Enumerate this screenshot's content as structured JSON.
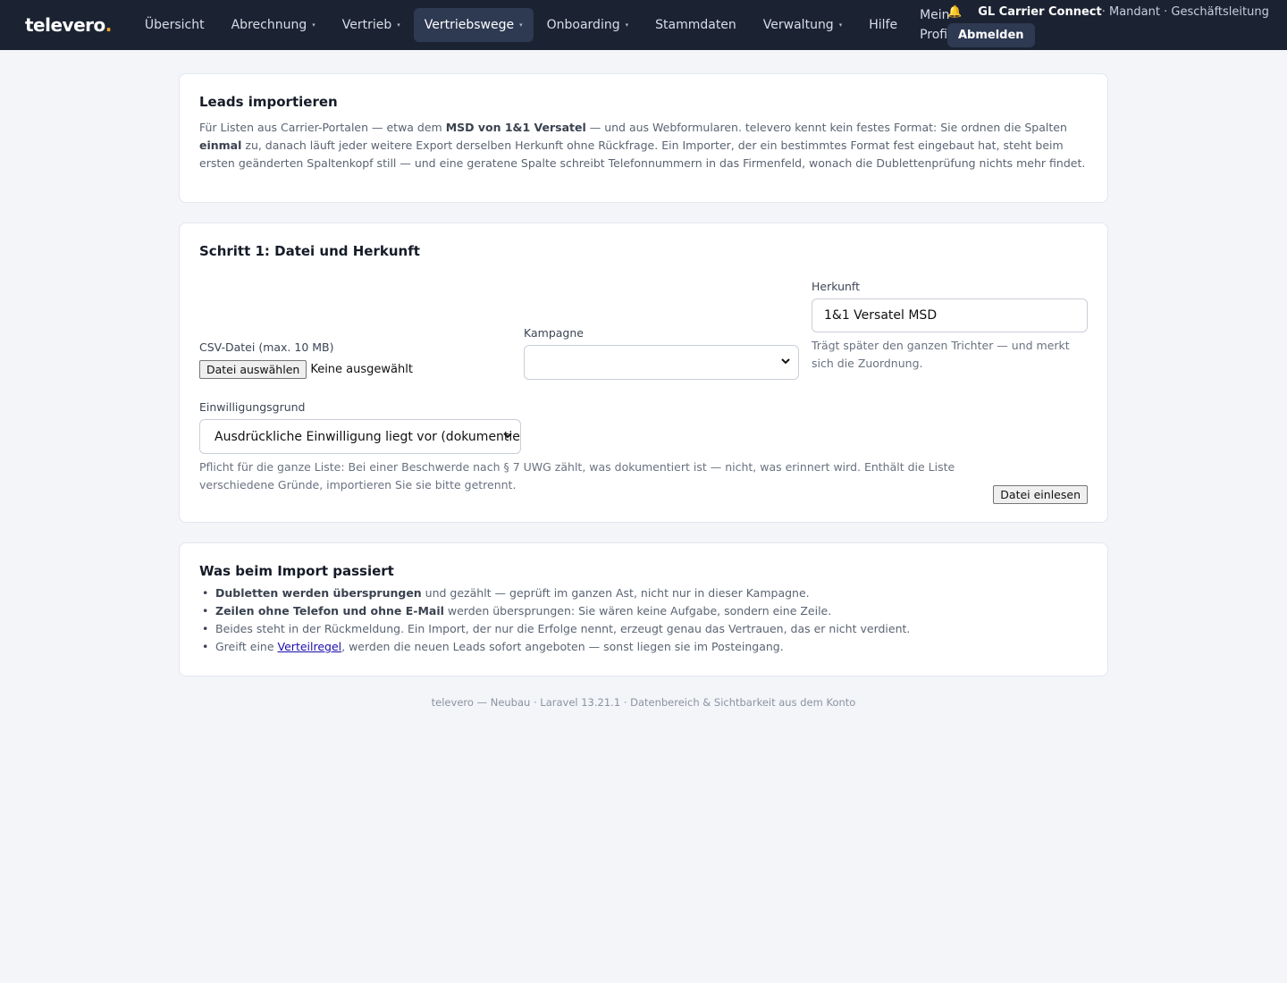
{
  "nav": {
    "logo": "televero",
    "logo_dot": ".",
    "items": [
      {
        "label": "Übersicht",
        "caret": false
      },
      {
        "label": "Abrechnung",
        "caret": true
      },
      {
        "label": "Vertrieb",
        "caret": true
      },
      {
        "label": "Vertriebswege",
        "caret": true,
        "active": true
      },
      {
        "label": "Onboarding",
        "caret": true
      },
      {
        "label": "Stammdaten",
        "caret": false
      },
      {
        "label": "Verwaltung",
        "caret": true
      },
      {
        "label": "Hilfe",
        "caret": false
      },
      {
        "label": "Mein Profil",
        "caret": false
      }
    ],
    "caret_glyph": "▾",
    "user": {
      "bell": "🔔",
      "tenant": "GL Carrier Connect",
      "role": " · Mandant · Geschäftsleitung",
      "logout": "Abmelden"
    }
  },
  "intro": {
    "title": "Leads importieren",
    "p1": "Für Listen aus Carrier-Portalen — etwa dem ",
    "b1": "MSD von 1&1 Versatel",
    "p2": " — und aus Webformularen. televero kennt kein festes Format: Sie ordnen die Spalten ",
    "b2": "einmal",
    "p3": " zu, danach läuft jeder weitere Export derselben Herkunft ohne Rückfrage. Ein Importer, der ein bestimmtes Format fest eingebaut hat, steht beim ersten geänderten Spaltenkopf still — und eine geratene Spalte schreibt Telefonnummern in das Firmenfeld, wonach die Dublettenprüfung nichts mehr findet."
  },
  "step1": {
    "title": "Schritt 1: Datei und Herkunft",
    "csv_label": "CSV-Datei (max. 10 MB)",
    "file_button": "Datei auswählen",
    "file_status": "Keine ausgewählt",
    "campaign_label": "Kampagne",
    "campaign_value": "",
    "origin_label": "Herkunft",
    "origin_value": "1&1 Versatel MSD",
    "origin_hint": "Trägt später den ganzen Trichter — und merkt sich die Zuordnung.",
    "consent_label": "Einwilligungsgrund",
    "consent_value": "Ausdrückliche Einwilligung liegt vor (dokumentiert)",
    "consent_hint": "Pflicht für die ganze Liste: Bei einer Beschwerde nach § 7 UWG zählt, was dokumentiert ist — nicht, was erinnert wird. Enthält die Liste verschiedene Gründe, importieren Sie sie bitte getrennt.",
    "submit": "Datei einlesen",
    "chevron": "⌄"
  },
  "info": {
    "title": "Was beim Import passiert",
    "li1_b": "Dubletten werden übersprungen",
    "li1": " und gezählt — geprüft im ganzen Ast, nicht nur in dieser Kampagne.",
    "li2_b": "Zeilen ohne Telefon und ohne E-Mail",
    "li2": " werden übersprungen: Sie wären keine Aufgabe, sondern eine Zeile.",
    "li3": "Beides steht in der Rückmeldung. Ein Import, der nur die Erfolge nennt, erzeugt genau das Vertrauen, das er nicht verdient.",
    "li4_pre": "Greift eine ",
    "li4_link": "Verteilregel",
    "li4_post": ", werden die neuen Leads sofort angeboten — sonst liegen sie im Posteingang."
  },
  "footer": "televero — Neubau · Laravel 13.21.1 · Datenbereich & Sichtbarkeit aus dem Konto"
}
